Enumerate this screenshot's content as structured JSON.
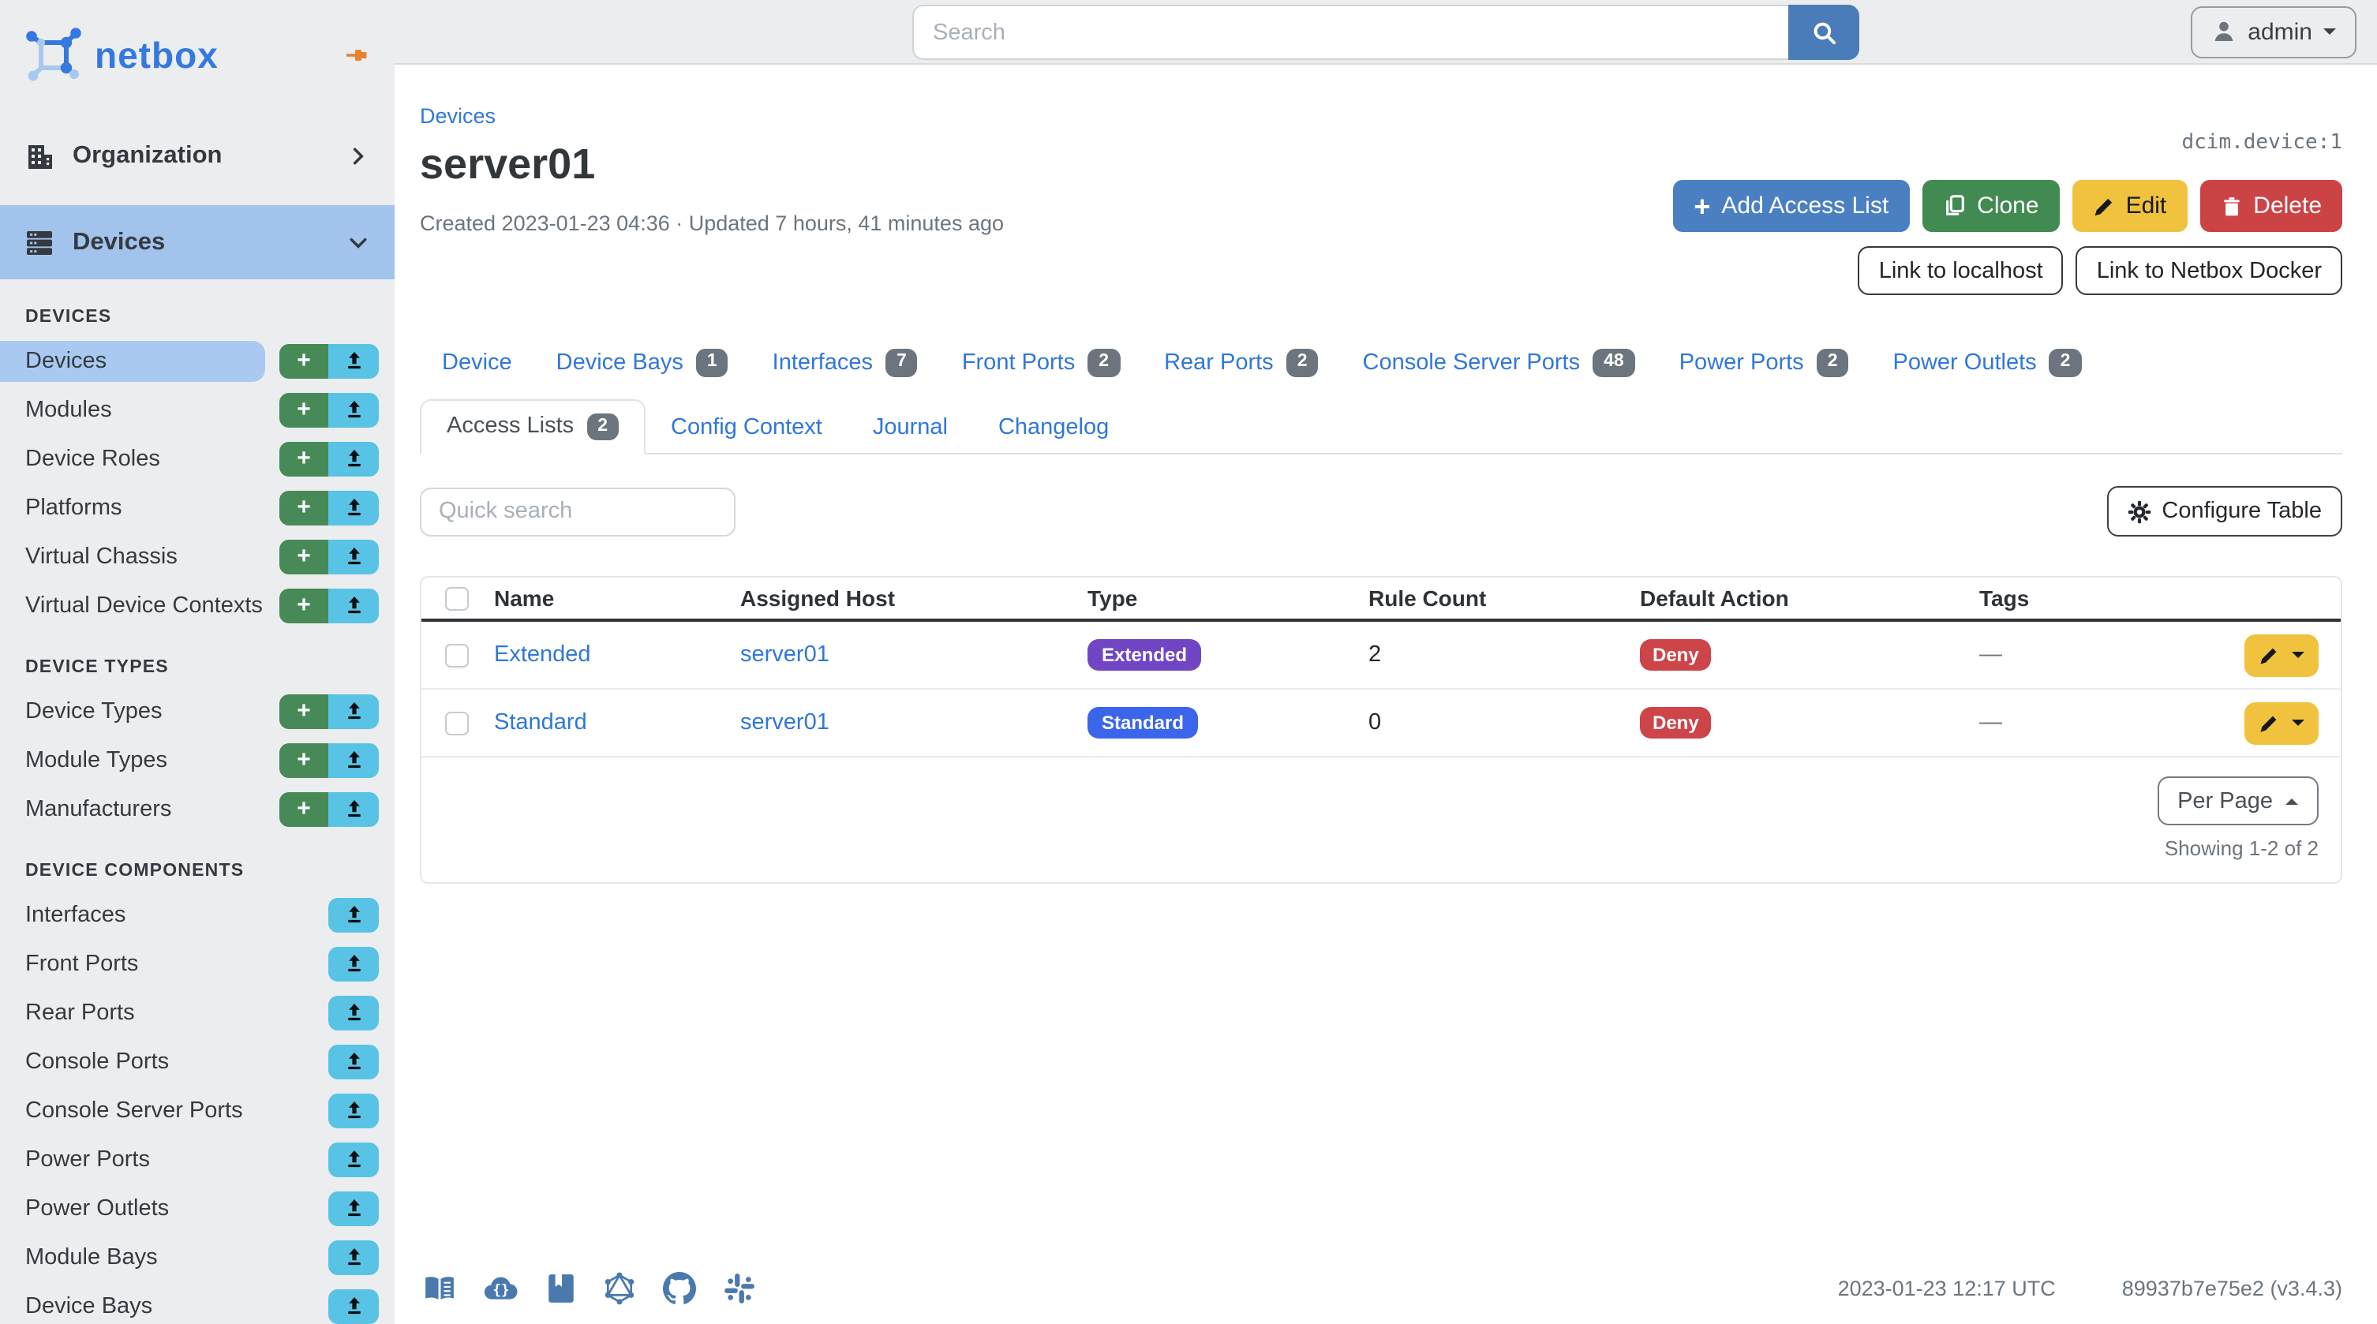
{
  "topbar": {
    "search_placeholder": "Search",
    "user_label": "admin"
  },
  "sidebar": {
    "logo_text": "netbox",
    "sections": [
      {
        "label": "Organization",
        "active": false
      },
      {
        "label": "Devices",
        "active": true
      }
    ],
    "groups": [
      {
        "label": "DEVICES",
        "items": [
          {
            "label": "Devices",
            "active": true,
            "add": true,
            "import": true
          },
          {
            "label": "Modules",
            "add": true,
            "import": true
          },
          {
            "label": "Device Roles",
            "add": true,
            "import": true
          },
          {
            "label": "Platforms",
            "add": true,
            "import": true
          },
          {
            "label": "Virtual Chassis",
            "add": true,
            "import": true
          },
          {
            "label": "Virtual Device Contexts",
            "add": true,
            "import": true
          }
        ]
      },
      {
        "label": "DEVICE TYPES",
        "items": [
          {
            "label": "Device Types",
            "add": true,
            "import": true
          },
          {
            "label": "Module Types",
            "add": true,
            "import": true
          },
          {
            "label": "Manufacturers",
            "add": true,
            "import": true
          }
        ]
      },
      {
        "label": "DEVICE COMPONENTS",
        "items": [
          {
            "label": "Interfaces",
            "import": true
          },
          {
            "label": "Front Ports",
            "import": true
          },
          {
            "label": "Rear Ports",
            "import": true
          },
          {
            "label": "Console Ports",
            "import": true
          },
          {
            "label": "Console Server Ports",
            "import": true
          },
          {
            "label": "Power Ports",
            "import": true
          },
          {
            "label": "Power Outlets",
            "import": true
          },
          {
            "label": "Module Bays",
            "import": true
          },
          {
            "label": "Device Bays",
            "import": true
          }
        ]
      }
    ]
  },
  "header": {
    "breadcrumb": "Devices",
    "title": "server01",
    "meta": "Created 2023-01-23 04:36 · Updated 7 hours, 41 minutes ago",
    "object_id": "dcim.device:1",
    "actions": {
      "add_access_list": "Add Access List",
      "clone": "Clone",
      "edit": "Edit",
      "delete": "Delete"
    },
    "custom_links": [
      "Link to localhost",
      "Link to Netbox Docker"
    ]
  },
  "tabs": [
    {
      "label": "Device"
    },
    {
      "label": "Device Bays",
      "badge": "1"
    },
    {
      "label": "Interfaces",
      "badge": "7"
    },
    {
      "label": "Front Ports",
      "badge": "2"
    },
    {
      "label": "Rear Ports",
      "badge": "2"
    },
    {
      "label": "Console Server Ports",
      "badge": "48"
    },
    {
      "label": "Power Ports",
      "badge": "2"
    },
    {
      "label": "Power Outlets",
      "badge": "2"
    }
  ],
  "subtabs": [
    {
      "label": "Access Lists",
      "badge": "2",
      "active": true
    },
    {
      "label": "Config Context"
    },
    {
      "label": "Journal"
    },
    {
      "label": "Changelog"
    }
  ],
  "toolbar": {
    "quick_search_placeholder": "Quick search",
    "configure_table_label": "Configure Table"
  },
  "table": {
    "columns": [
      "Name",
      "Assigned Host",
      "Type",
      "Rule Count",
      "Default Action",
      "Tags"
    ],
    "rows": [
      {
        "name": "Extended",
        "assigned_host": "server01",
        "type": "Extended",
        "type_color": "#7146c5",
        "rule_count": "2",
        "default_action": "Deny",
        "tags": "—"
      },
      {
        "name": "Standard",
        "assigned_host": "server01",
        "type": "Standard",
        "type_color": "#3b65eb",
        "rule_count": "0",
        "default_action": "Deny",
        "tags": "—"
      }
    ]
  },
  "pagination": {
    "per_page_label": "Per Page",
    "showing": "Showing 1-2 of 2"
  },
  "footer": {
    "icons": [
      "docs-book",
      "rest-api-cloud",
      "api-docs-bookmark",
      "graphql",
      "github",
      "slack"
    ],
    "timestamp": "2023-01-23 12:17 UTC",
    "build": "89937b7e75e2 (v3.4.3)"
  },
  "colors": {
    "accent_blue": "#3077d9",
    "primary_btn": "#4a80c2",
    "green_btn": "#418a52",
    "yellow_btn": "#f0c23e",
    "red_btn": "#cc4346",
    "deny_badge": "#cd4449",
    "sidebar_active": "#a9c9f1",
    "badge_gray": "#6c757d"
  }
}
